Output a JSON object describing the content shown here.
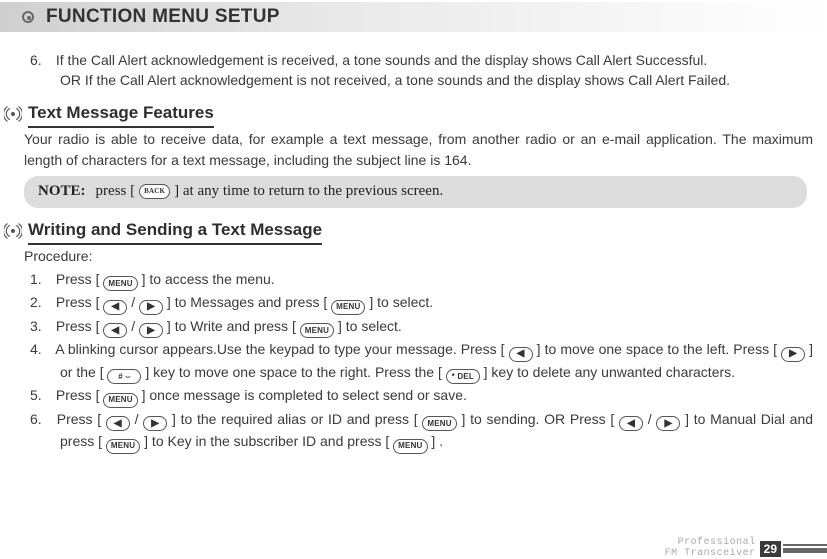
{
  "title": "FUNCTION MENU SETUP",
  "item6": {
    "num": "6.",
    "line1": "If the Call Alert acknowledgement is received, a tone sounds and the display shows Call Alert Successful.",
    "line2": "OR If the Call Alert acknowledgement is not received, a tone sounds and the display shows Call Alert Failed."
  },
  "section_tmf": {
    "title": "Text Message Features",
    "body": "Your radio is able to receive data, for example a text message, from another radio or an e-mail application. The maximum length of characters for a text message, including the subject line is 164."
  },
  "note": {
    "label": "NOTE:",
    "pre": "press [",
    "post": "] at any time to return to the previous screen."
  },
  "section_ws": {
    "title": "Writing and Sending a Text Message"
  },
  "proc": {
    "head": "Procedure:",
    "s1": {
      "n": "1.",
      "a": "Press [",
      "b": "] to access the menu."
    },
    "s2": {
      "n": "2.",
      "a": "Press [",
      "mid": "/",
      "b": "] to Messages and press [",
      "c": "] to select."
    },
    "s3": {
      "n": "3.",
      "a": "Press [",
      "mid": "/",
      "b": "] to Write and press [",
      "c": "] to select."
    },
    "s4": {
      "n": "4.",
      "a": "A blinking cursor appears.Use the keypad to type your message. Press [",
      "b": "] to move one space to the left. Press [",
      "c": "] or the [",
      "d": "] key to move one space to the right. Press the [",
      "e": "] key to delete any unwanted characters."
    },
    "s5": {
      "n": "5.",
      "a": "Press [",
      "b": "] once message is completed to select send or save."
    },
    "s6": {
      "n": "6.",
      "a": "Press [",
      "mid": "/",
      "b": "] to the required alias or ID and press [",
      "c": "] to sending. OR Press  [",
      "d": "/",
      "e": "]  to Manual Dial and press [",
      "f": "] to Key in the subscriber ID and press [",
      "g": "] ."
    }
  },
  "btn": {
    "menu": "MENU",
    "back": "BACK",
    "left": "◀",
    "right": "▶",
    "hash": "# ⌣",
    "del": "* DEL"
  },
  "footer": {
    "l1": "Professional",
    "l2": "FM Transceiver",
    "page": "29"
  }
}
